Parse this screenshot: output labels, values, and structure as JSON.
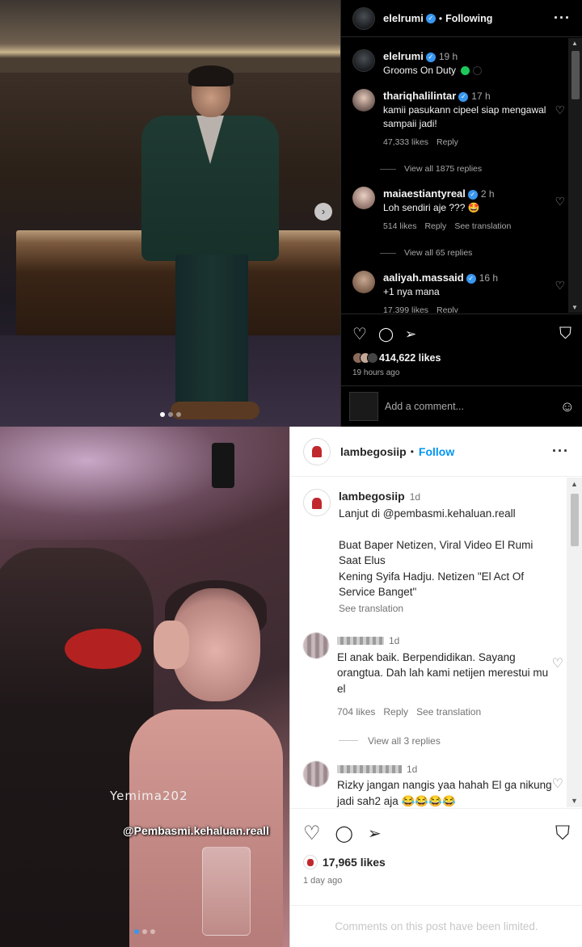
{
  "post1": {
    "author": "elelrumi",
    "follow_status": "Following",
    "caption": {
      "username": "elelrumi",
      "time": "19 h",
      "text": "Grooms On Duty"
    },
    "comments": [
      {
        "username": "thariqhalilintar",
        "time": "17 h",
        "text": "kamii pasukann cipeel siap mengawal sampaii jadi!",
        "likes": "47,333 likes",
        "reply": "Reply",
        "view_all": "View all 1875 replies"
      },
      {
        "username": "maiaestiantyreal",
        "time": "2 h",
        "text": "Loh sendiri aje ??? 🤩",
        "likes": "514 likes",
        "reply": "Reply",
        "translate": "See translation",
        "view_all": "View all 65 replies"
      },
      {
        "username": "aaliyah.massaid",
        "time": "16 h",
        "text": "+1 nya mana",
        "likes": "17,399 likes",
        "reply": "Reply"
      }
    ],
    "likes": "414,622 likes",
    "posted": "19 hours ago",
    "comment_placeholder": "Add a comment..."
  },
  "post2": {
    "author": "lambegosiip",
    "follow_label": "Follow",
    "caption": {
      "username": "lambegosiip",
      "time": "1d",
      "line1": "Lanjut di @pembasmi.kehaluan.reall",
      "line2": "Buat Baper Netizen, Viral Video El Rumi Saat Elus",
      "line3": "Kening Syifa Hadju. Netizen \"El Act Of Service Banget\"",
      "translate": "See translation"
    },
    "comments": [
      {
        "time": "1d",
        "text": "El anak baik. Berpendidikan. Sayang orangtua. Dah lah kami netijen merestui mu el",
        "likes": "704 likes",
        "reply": "Reply",
        "translate": "See translation",
        "view_all": "View all 3 replies"
      },
      {
        "time": "1d",
        "text": "Rizky jangan nangis yaa hahah El ga nikung jadi sah2 aja 😂😂😂😂"
      }
    ],
    "watermark1": "Yemima202",
    "watermark2": "@Pembasmi.kehaluan.reall",
    "likes": "17,965 likes",
    "posted": "1 day ago",
    "limited_notice": "Comments on this post have been limited."
  },
  "icons": {
    "heart": "♡",
    "comment": "◯",
    "share": "➢",
    "bookmark": "⛉",
    "more": "···",
    "emoji": "☺",
    "next": "›",
    "verified": "✓"
  }
}
